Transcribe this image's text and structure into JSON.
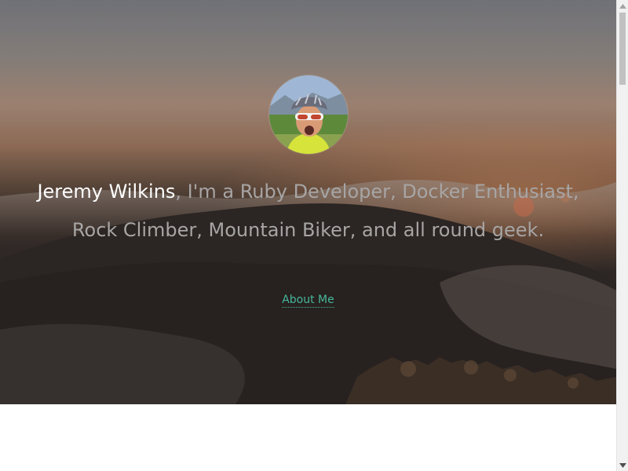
{
  "profile": {
    "name": "Jeremy Wilkins",
    "tagline": ", I'm a Ruby Developer, Docker Enthusiast, Rock Climber, Mountain Biker, and all round geek.",
    "avatar_icon": "profile-photo-avatar"
  },
  "nav": {
    "about_label": "About Me"
  },
  "colors": {
    "link": "#47b79a",
    "name": "#ffffff",
    "tagline": "#a7a5a5"
  },
  "scrollbar": {
    "up_icon": "chevron-up-icon",
    "down_icon": "chevron-down-icon"
  }
}
